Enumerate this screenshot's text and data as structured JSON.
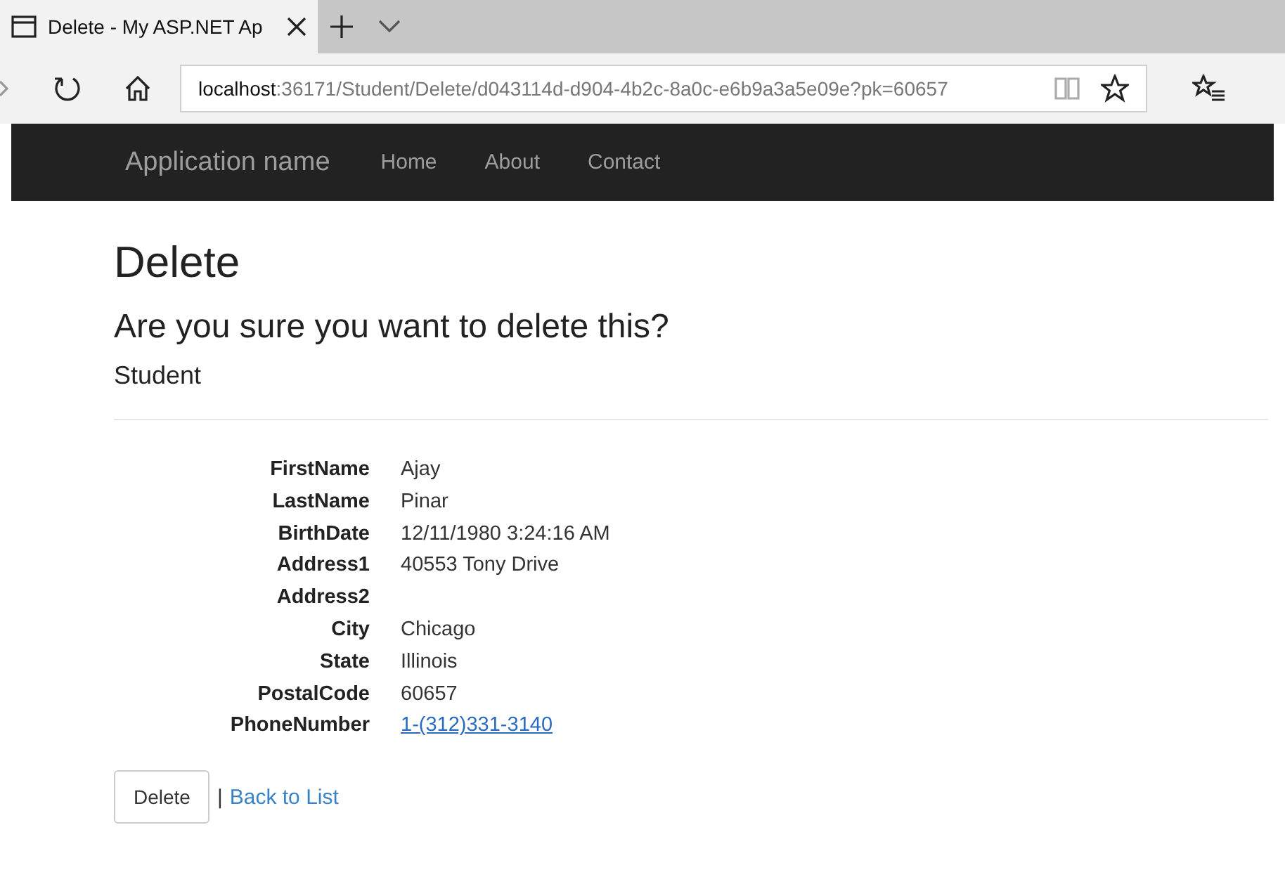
{
  "browser": {
    "tab": {
      "title": "Delete - My ASP.NET Ap",
      "selected": true
    },
    "url": {
      "host": "localhost",
      "path": ":36171/Student/Delete/d043114d-d904-4b2c-8a0c-e6b9a3a5e09e?pk=60657"
    }
  },
  "navbar": {
    "brand": "Application name",
    "links": [
      "Home",
      "About",
      "Contact"
    ]
  },
  "page": {
    "title": "Delete",
    "question": "Are you sure you want to delete this?",
    "entity": "Student",
    "fields": [
      {
        "label": "FirstName",
        "value": "Ajay",
        "kind": "text"
      },
      {
        "label": "LastName",
        "value": "Pinar",
        "kind": "text"
      },
      {
        "label": "BirthDate",
        "value": "12/11/1980 3:24:16 AM",
        "kind": "text"
      },
      {
        "label": "Address1",
        "value": "40553 Tony Drive",
        "kind": "text"
      },
      {
        "label": "Address2",
        "kind": "text"
      },
      {
        "label": "City",
        "value": "Chicago",
        "kind": "text"
      },
      {
        "label": "State",
        "value": "Illinois",
        "kind": "text"
      },
      {
        "label": "PostalCode",
        "value": "60657",
        "kind": "text"
      },
      {
        "label": "PhoneNumber",
        "value": "1-(312)331-3140",
        "kind": "link"
      }
    ],
    "delete_button": "Delete",
    "separator": "|",
    "back_link": "Back to List"
  }
}
